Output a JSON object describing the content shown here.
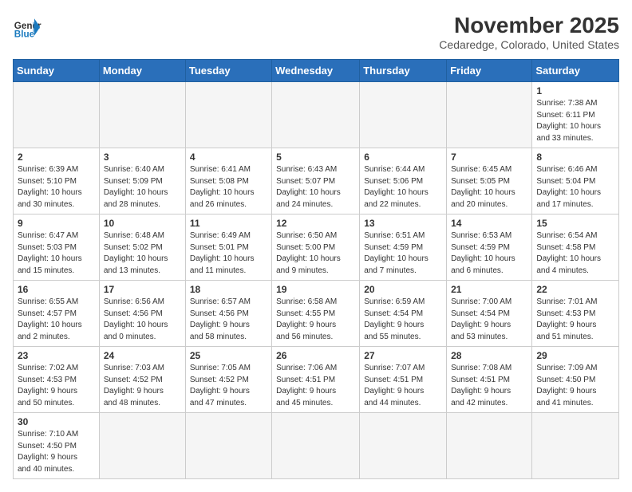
{
  "header": {
    "logo_general": "General",
    "logo_blue": "Blue",
    "title": "November 2025",
    "subtitle": "Cedaredge, Colorado, United States"
  },
  "days_of_week": [
    "Sunday",
    "Monday",
    "Tuesday",
    "Wednesday",
    "Thursday",
    "Friday",
    "Saturday"
  ],
  "weeks": [
    [
      {
        "day": "",
        "info": ""
      },
      {
        "day": "",
        "info": ""
      },
      {
        "day": "",
        "info": ""
      },
      {
        "day": "",
        "info": ""
      },
      {
        "day": "",
        "info": ""
      },
      {
        "day": "",
        "info": ""
      },
      {
        "day": "1",
        "info": "Sunrise: 7:38 AM\nSunset: 6:11 PM\nDaylight: 10 hours\nand 33 minutes."
      }
    ],
    [
      {
        "day": "2",
        "info": "Sunrise: 6:39 AM\nSunset: 5:10 PM\nDaylight: 10 hours\nand 30 minutes."
      },
      {
        "day": "3",
        "info": "Sunrise: 6:40 AM\nSunset: 5:09 PM\nDaylight: 10 hours\nand 28 minutes."
      },
      {
        "day": "4",
        "info": "Sunrise: 6:41 AM\nSunset: 5:08 PM\nDaylight: 10 hours\nand 26 minutes."
      },
      {
        "day": "5",
        "info": "Sunrise: 6:43 AM\nSunset: 5:07 PM\nDaylight: 10 hours\nand 24 minutes."
      },
      {
        "day": "6",
        "info": "Sunrise: 6:44 AM\nSunset: 5:06 PM\nDaylight: 10 hours\nand 22 minutes."
      },
      {
        "day": "7",
        "info": "Sunrise: 6:45 AM\nSunset: 5:05 PM\nDaylight: 10 hours\nand 20 minutes."
      },
      {
        "day": "8",
        "info": "Sunrise: 6:46 AM\nSunset: 5:04 PM\nDaylight: 10 hours\nand 17 minutes."
      }
    ],
    [
      {
        "day": "9",
        "info": "Sunrise: 6:47 AM\nSunset: 5:03 PM\nDaylight: 10 hours\nand 15 minutes."
      },
      {
        "day": "10",
        "info": "Sunrise: 6:48 AM\nSunset: 5:02 PM\nDaylight: 10 hours\nand 13 minutes."
      },
      {
        "day": "11",
        "info": "Sunrise: 6:49 AM\nSunset: 5:01 PM\nDaylight: 10 hours\nand 11 minutes."
      },
      {
        "day": "12",
        "info": "Sunrise: 6:50 AM\nSunset: 5:00 PM\nDaylight: 10 hours\nand 9 minutes."
      },
      {
        "day": "13",
        "info": "Sunrise: 6:51 AM\nSunset: 4:59 PM\nDaylight: 10 hours\nand 7 minutes."
      },
      {
        "day": "14",
        "info": "Sunrise: 6:53 AM\nSunset: 4:59 PM\nDaylight: 10 hours\nand 6 minutes."
      },
      {
        "day": "15",
        "info": "Sunrise: 6:54 AM\nSunset: 4:58 PM\nDaylight: 10 hours\nand 4 minutes."
      }
    ],
    [
      {
        "day": "16",
        "info": "Sunrise: 6:55 AM\nSunset: 4:57 PM\nDaylight: 10 hours\nand 2 minutes."
      },
      {
        "day": "17",
        "info": "Sunrise: 6:56 AM\nSunset: 4:56 PM\nDaylight: 10 hours\nand 0 minutes."
      },
      {
        "day": "18",
        "info": "Sunrise: 6:57 AM\nSunset: 4:56 PM\nDaylight: 9 hours\nand 58 minutes."
      },
      {
        "day": "19",
        "info": "Sunrise: 6:58 AM\nSunset: 4:55 PM\nDaylight: 9 hours\nand 56 minutes."
      },
      {
        "day": "20",
        "info": "Sunrise: 6:59 AM\nSunset: 4:54 PM\nDaylight: 9 hours\nand 55 minutes."
      },
      {
        "day": "21",
        "info": "Sunrise: 7:00 AM\nSunset: 4:54 PM\nDaylight: 9 hours\nand 53 minutes."
      },
      {
        "day": "22",
        "info": "Sunrise: 7:01 AM\nSunset: 4:53 PM\nDaylight: 9 hours\nand 51 minutes."
      }
    ],
    [
      {
        "day": "23",
        "info": "Sunrise: 7:02 AM\nSunset: 4:53 PM\nDaylight: 9 hours\nand 50 minutes."
      },
      {
        "day": "24",
        "info": "Sunrise: 7:03 AM\nSunset: 4:52 PM\nDaylight: 9 hours\nand 48 minutes."
      },
      {
        "day": "25",
        "info": "Sunrise: 7:05 AM\nSunset: 4:52 PM\nDaylight: 9 hours\nand 47 minutes."
      },
      {
        "day": "26",
        "info": "Sunrise: 7:06 AM\nSunset: 4:51 PM\nDaylight: 9 hours\nand 45 minutes."
      },
      {
        "day": "27",
        "info": "Sunrise: 7:07 AM\nSunset: 4:51 PM\nDaylight: 9 hours\nand 44 minutes."
      },
      {
        "day": "28",
        "info": "Sunrise: 7:08 AM\nSunset: 4:51 PM\nDaylight: 9 hours\nand 42 minutes."
      },
      {
        "day": "29",
        "info": "Sunrise: 7:09 AM\nSunset: 4:50 PM\nDaylight: 9 hours\nand 41 minutes."
      }
    ],
    [
      {
        "day": "30",
        "info": "Sunrise: 7:10 AM\nSunset: 4:50 PM\nDaylight: 9 hours\nand 40 minutes."
      },
      {
        "day": "",
        "info": ""
      },
      {
        "day": "",
        "info": ""
      },
      {
        "day": "",
        "info": ""
      },
      {
        "day": "",
        "info": ""
      },
      {
        "day": "",
        "info": ""
      },
      {
        "day": "",
        "info": ""
      }
    ]
  ]
}
